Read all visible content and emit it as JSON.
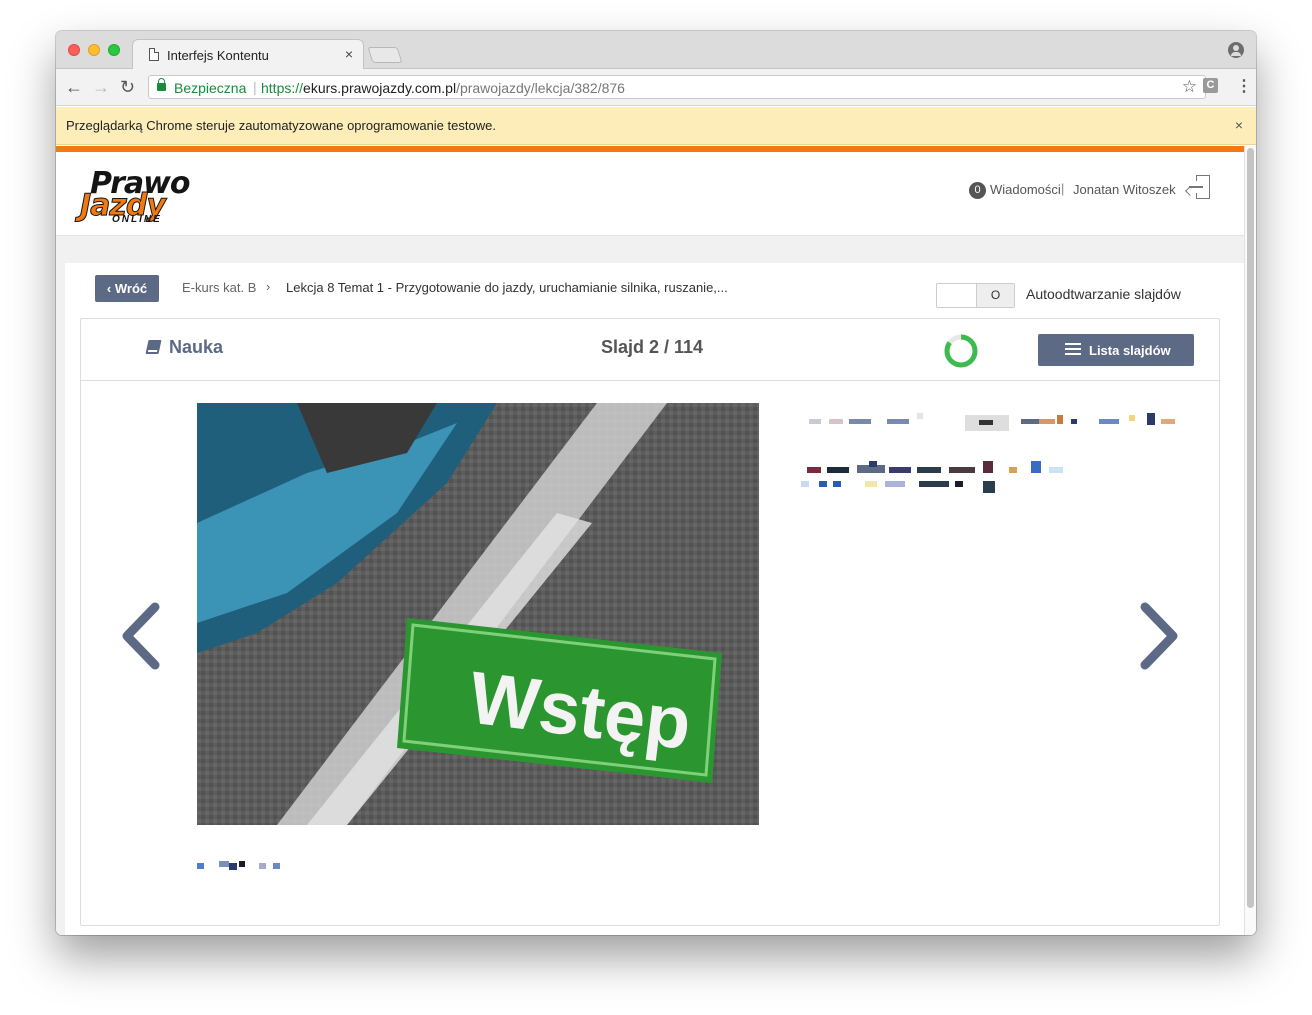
{
  "browser": {
    "tab_title": "Interfejs Kontentu",
    "tab_close": "×",
    "secure_label": "Bezpieczna",
    "url_scheme": "https://",
    "url_host": "ekurs.prawojazdy.com.pl",
    "url_path": "/prawojazdy/lekcja/382/876",
    "extension_letter": "C",
    "infobar_text": "Przeglądarką Chrome steruje zautomatyzowane oprogramowanie testowe.",
    "infobar_close": "×"
  },
  "header": {
    "logo_line1": "Prawo",
    "logo_line2": "Jazdy",
    "logo_line3": "ONLINE",
    "messages_count": "0",
    "messages_label": "Wiadomości",
    "separator": "|",
    "user_name": "Jonatan Witoszek"
  },
  "breadcrumb": {
    "back_label": "Wróć",
    "root": "E-kurs kat. B",
    "separator": "›",
    "current": "Lekcja 8 Temat 1 - Przygotowanie do jazdy, uruchamianie silnika, ruszanie,..."
  },
  "autoplay": {
    "toggle_state": "O",
    "label": "Autoodtwarzanie slajdów"
  },
  "panel": {
    "section_label": "Nauka",
    "slide_counter": "Slajd 2 / 114",
    "list_button_label": "Lista slajdów",
    "progress": 0.85
  },
  "slide": {
    "image_sign_text": "Wstęp"
  },
  "colors": {
    "accent_orange": "#f07a11",
    "button_slate": "#5d6a86",
    "progress_green": "#3dbb4e",
    "secure_green": "#1a8a3c",
    "infobar_yellow": "#fdeeb9"
  },
  "icons": {
    "back": "arrow-left-icon",
    "forward": "arrow-right-icon",
    "reload": "reload-icon",
    "bookmark": "star-icon",
    "menu": "kebab-menu-icon",
    "logout": "logout-icon",
    "section": "book-icon",
    "list": "hamburger-icon",
    "prev_slide": "chevron-left-icon",
    "next_slide": "chevron-right-icon"
  }
}
